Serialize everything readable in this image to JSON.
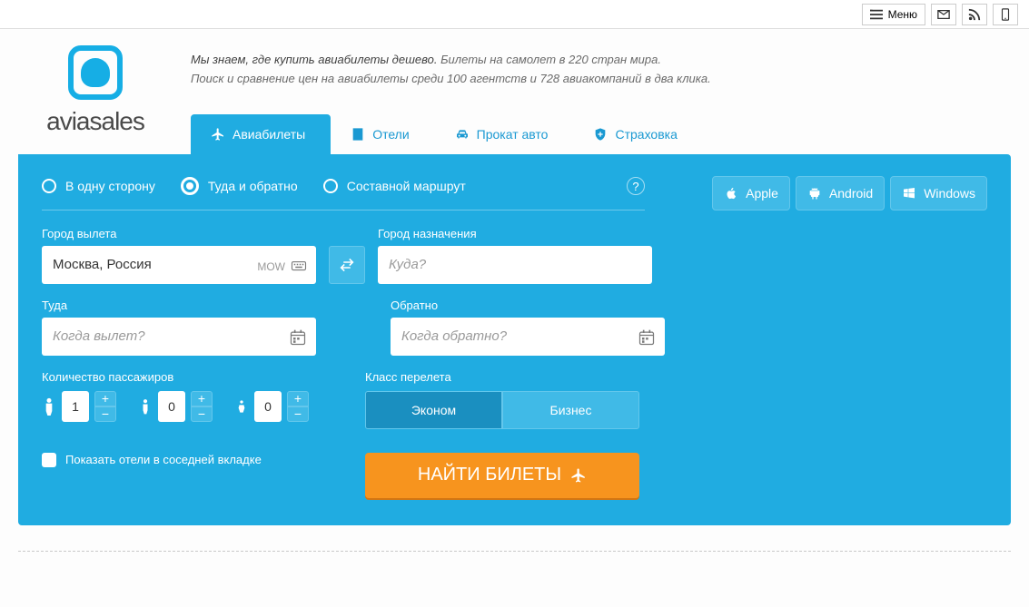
{
  "topbar": {
    "menu_label": "Меню"
  },
  "brand": {
    "name": "aviasales"
  },
  "tagline": {
    "line1_strong": "Мы знаем, где купить авиабилеты дешево.",
    "line1_rest": " Билеты на самолет в 220 стран мира.",
    "line2": "Поиск и сравнение цен на авиабилеты среди 100 агентств и 728 авиакомпаний в два клика."
  },
  "tabs": {
    "flights": "Авиабилеты",
    "hotels": "Отели",
    "cars": "Прокат авто",
    "insurance": "Страховка"
  },
  "trip_type": {
    "one_way": "В одну сторону",
    "round_trip": "Туда и обратно",
    "multi_city": "Составной маршрут"
  },
  "platforms": {
    "apple": "Apple",
    "android": "Android",
    "windows": "Windows"
  },
  "form": {
    "origin_label": "Город вылета",
    "origin_value": "Москва, Россия",
    "origin_code": "MOW",
    "dest_label": "Город назначения",
    "dest_placeholder": "Куда?",
    "depart_label": "Туда",
    "depart_placeholder": "Когда вылет?",
    "return_label": "Обратно",
    "return_placeholder": "Когда обратно?",
    "passengers_label": "Количество пассажиров",
    "adults": "1",
    "children": "0",
    "infants": "0",
    "class_label": "Класс перелета",
    "class_economy": "Эконом",
    "class_business": "Бизнес",
    "search_label": "НАЙТИ БИЛЕТЫ",
    "show_hotels": "Показать отели в соседней вкладке"
  }
}
